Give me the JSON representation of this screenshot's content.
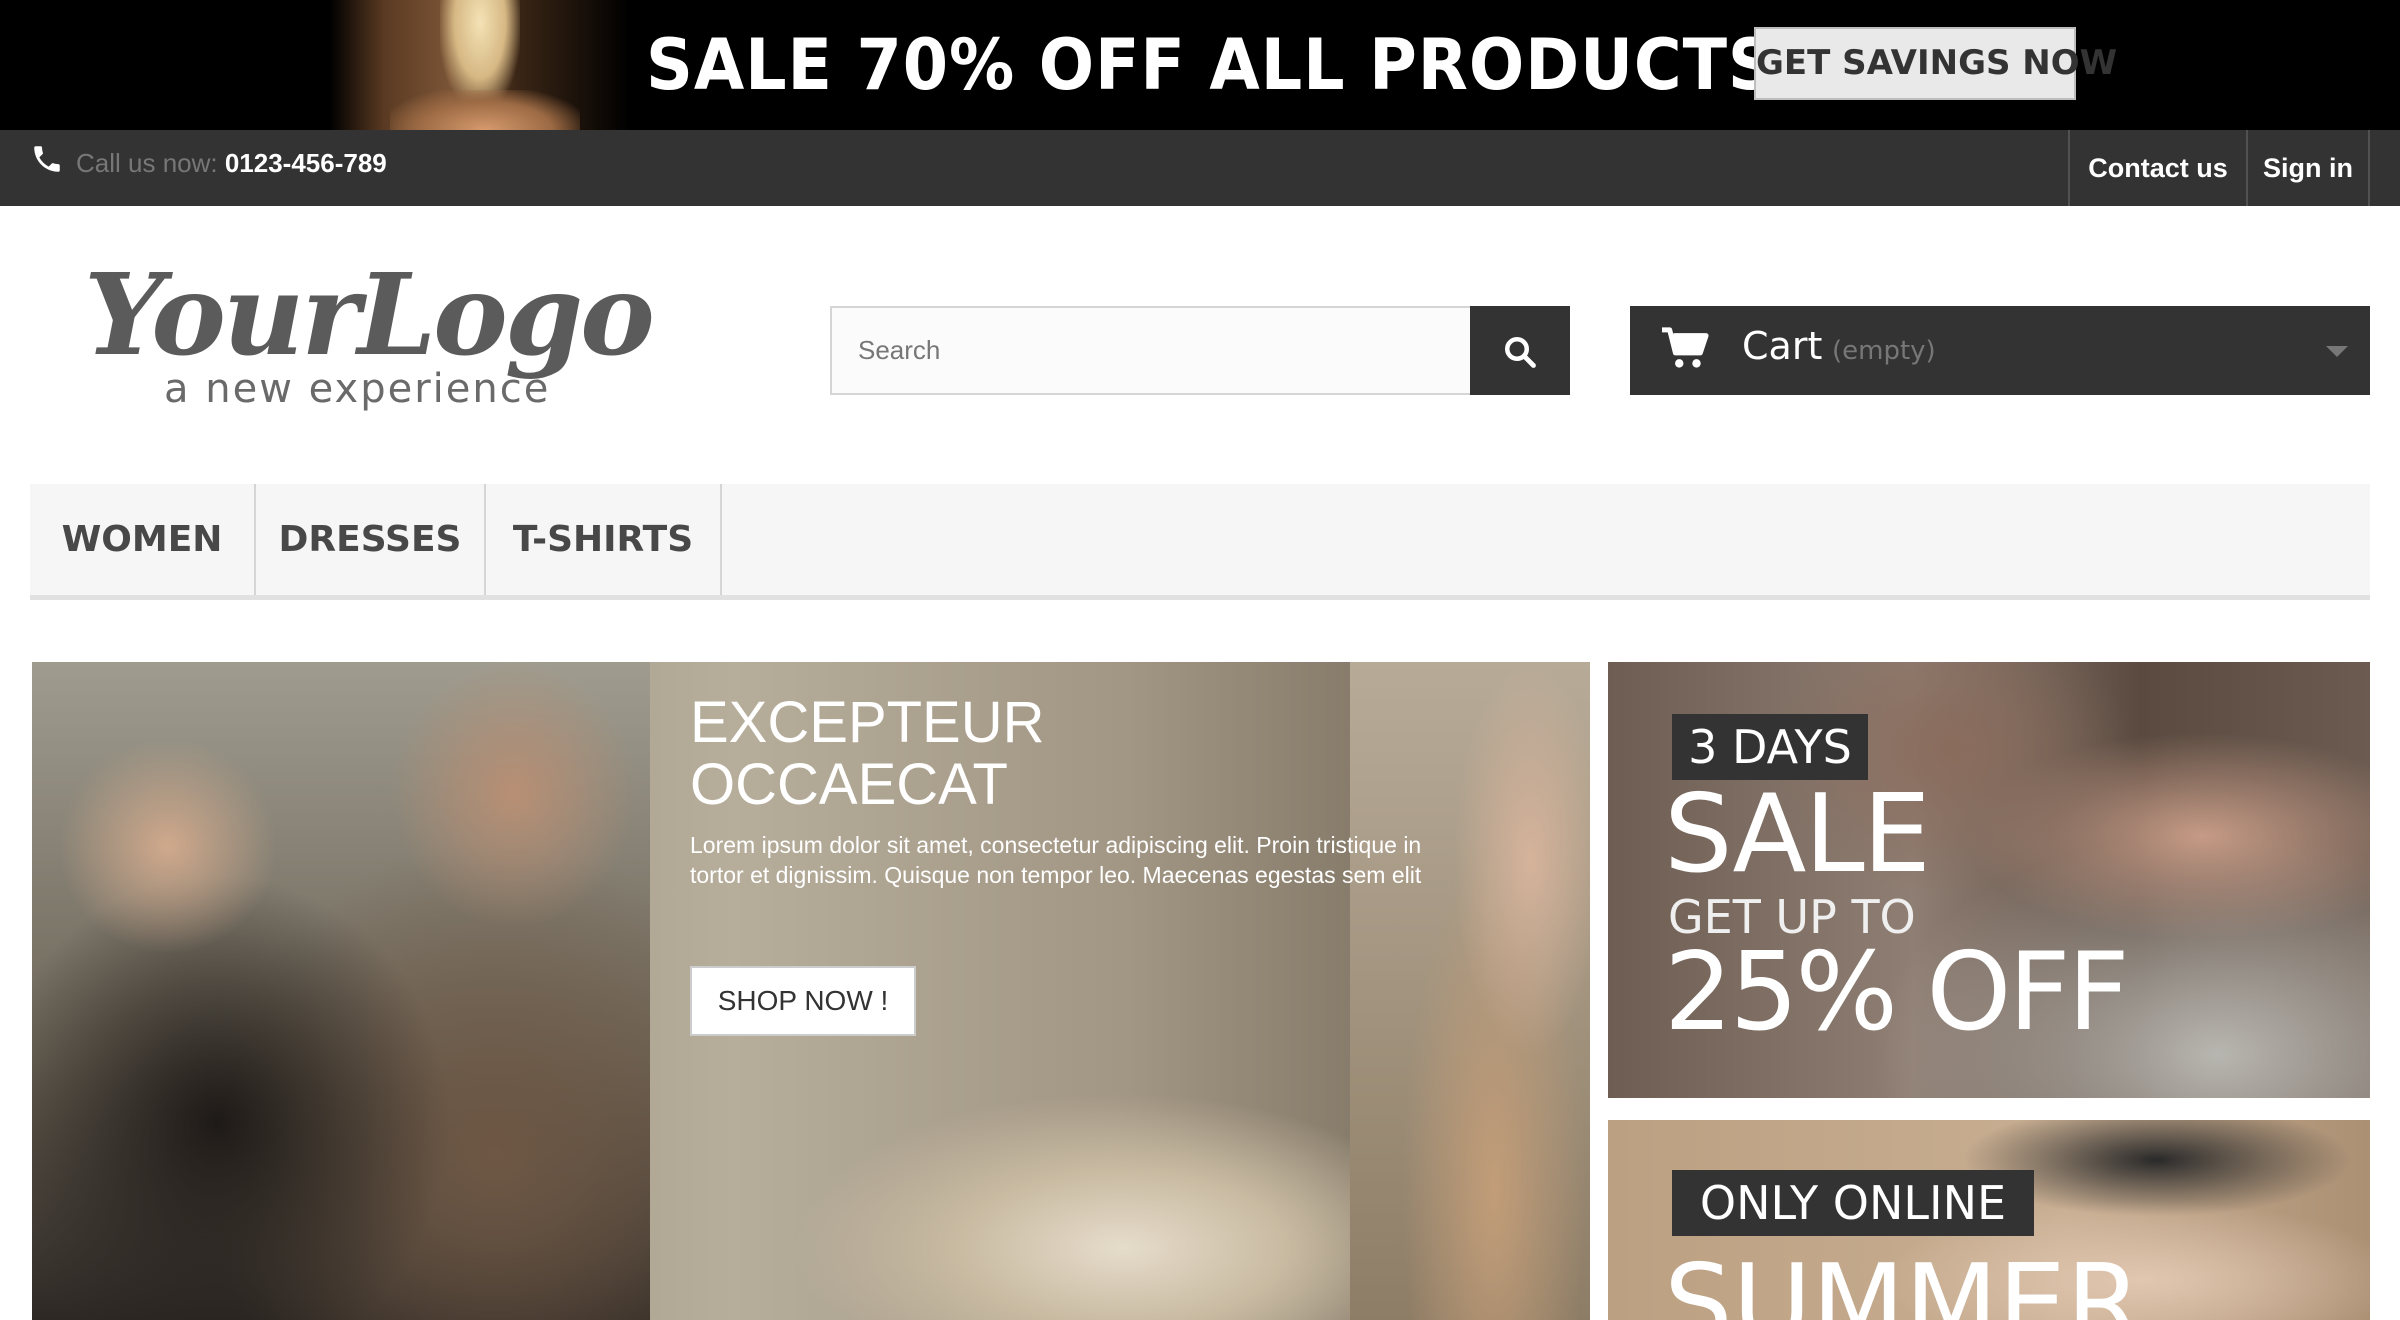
{
  "promo_banner": {
    "title": "SALE 70% OFF ALL PRODUCTS",
    "button_label": "GET SAVINGS NOW"
  },
  "topbar": {
    "call_label": "Call us now: ",
    "phone": "0123-456-789",
    "contact_label": "Contact us",
    "signin_label": "Sign in",
    "phone_icon": "phone-icon"
  },
  "header": {
    "logo_script": "YourLogo",
    "logo_tagline": "a new experience",
    "search": {
      "placeholder": "Search",
      "value": ""
    },
    "search_icon": "search-icon",
    "cart": {
      "label": "Cart",
      "status": "(empty)",
      "icon": "shopping-cart-icon"
    }
  },
  "menu": {
    "items": [
      {
        "label": "WOMEN"
      },
      {
        "label": "DRESSES"
      },
      {
        "label": "T-SHIRTS"
      }
    ]
  },
  "hero": {
    "title": "EXCEPTEUR\nOCCAECAT",
    "text": "Lorem ipsum dolor sit amet, consectetur adipiscing elit. Proin tristique in tortor et dignissim. Quisque non tempor leo. Maecenas egestas sem elit",
    "button_label": "SHOP NOW !"
  },
  "side_banners": [
    {
      "tag": "3 DAYS",
      "headline": "SALE",
      "subline": "GET UP TO",
      "offer": "25% OFF"
    },
    {
      "tag": "ONLY ONLINE",
      "headline": "SUMMER"
    }
  ],
  "colors": {
    "dark": "#333333",
    "promo_bg": "#000000",
    "menu_bg": "#f6f6f6",
    "muted_text": "#777777"
  }
}
